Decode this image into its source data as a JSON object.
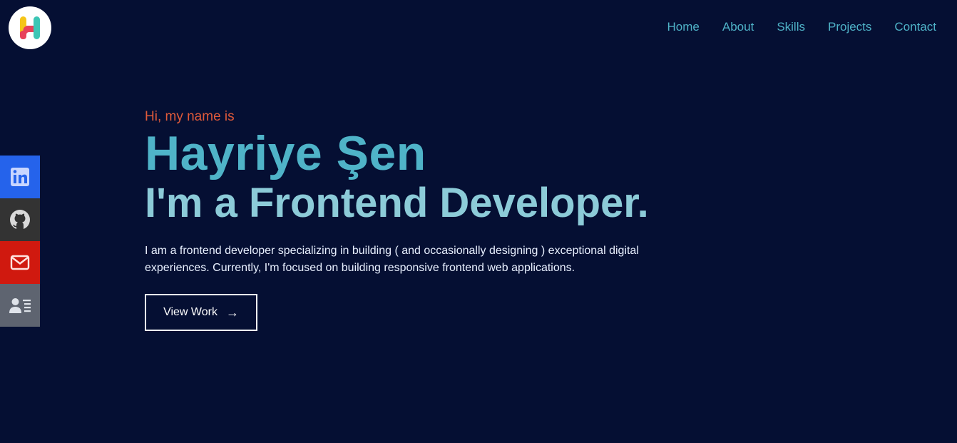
{
  "logo": {
    "icon": "h-logo-icon",
    "colors": [
      "#f5c518",
      "#e8425a",
      "#3cc6b5"
    ]
  },
  "nav": {
    "items": [
      {
        "label": "Home"
      },
      {
        "label": "About"
      },
      {
        "label": "Skills"
      },
      {
        "label": "Projects"
      },
      {
        "label": "Contact"
      }
    ]
  },
  "social": {
    "items": [
      {
        "icon": "linkedin-icon",
        "color": "#2563eb"
      },
      {
        "icon": "github-icon",
        "color": "#333333"
      },
      {
        "icon": "mail-icon",
        "color": "#d0190f"
      },
      {
        "icon": "resume-icon",
        "color": "#5e6470"
      }
    ]
  },
  "hero": {
    "greeting": "Hi, my name is",
    "name": "Hayriye Şen",
    "role": "I'm a Frontend Developer.",
    "description": "I am a frontend developer specializing in building ( and occasionally designing ) exceptional digital experiences. Currently, I'm focused on building responsive frontend web applications.",
    "cta_label": "View Work",
    "cta_arrow": "→"
  },
  "colors": {
    "background": "#050f33",
    "accent": "#4fb3c8",
    "greeting": "#e05a3a"
  }
}
